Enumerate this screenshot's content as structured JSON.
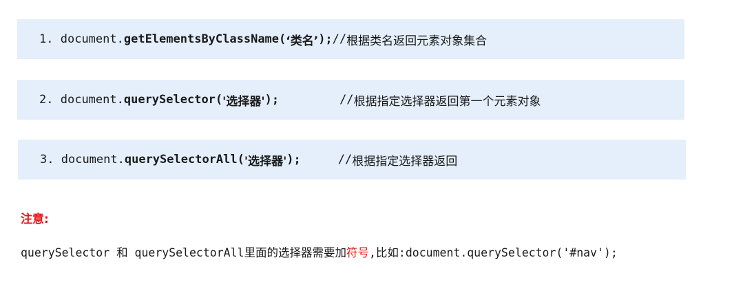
{
  "lines": [
    {
      "number": "1.",
      "object": "document.",
      "method": "getElementsByClassName(",
      "arg": "‘类名’",
      "close": ");",
      "comment_prefix": " // ",
      "comment": "根据类名返回元素对象集合"
    },
    {
      "number": "2.",
      "object": "document.",
      "method": "querySelector(",
      "arg": "'选择器'",
      "close": ");",
      "comment_prefix": "// ",
      "comment": "根据指定选择器返回第一个元素对象"
    },
    {
      "number": "3.",
      "object": "document.",
      "method": "querySelectorAll(",
      "arg": "'选择器'",
      "close": ");",
      "comment_prefix": "// ",
      "comment": "根据指定选择器返回"
    }
  ],
  "note": {
    "title": "注意:",
    "part1": "querySelector ",
    "part2": "和",
    "part3": " querySelectorAll",
    "part4": "里面的选择器需要加",
    "highlight": "符号",
    "part5": ",比如:",
    "part6": "document.querySelector('#nav');"
  },
  "colors": {
    "box_background": "#e4effb",
    "highlight": "#e8141a",
    "text": "#1a1a1a"
  }
}
